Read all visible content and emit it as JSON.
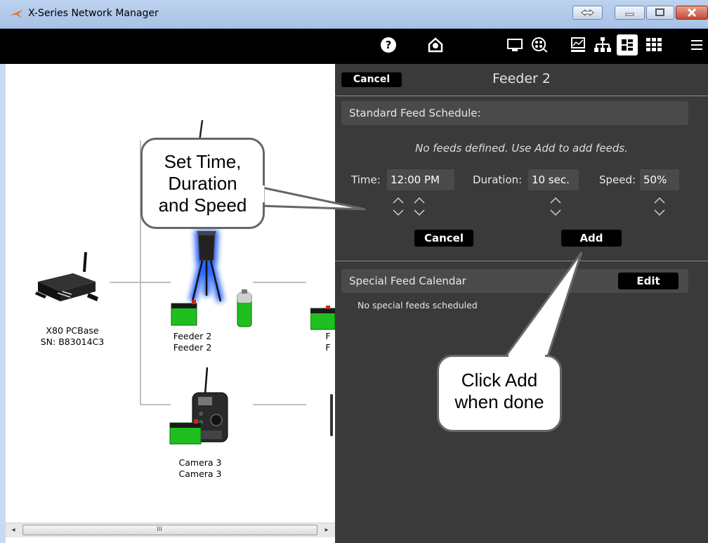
{
  "window": {
    "title": "X-Series Network Manager"
  },
  "toolbar": {
    "icons": [
      "help-icon",
      "support-icon",
      "monitor-icon",
      "camera-film-icon",
      "chart-icon",
      "network-icon",
      "grid-view-icon",
      "apps-icon",
      "menu-icon"
    ]
  },
  "network": {
    "base": {
      "name": "X80 PCBase",
      "serial": "SN: B83014C3"
    },
    "feeder": {
      "name": "Feeder 2",
      "sub": "Feeder 2"
    },
    "camera": {
      "name": "Camera 3",
      "sub": "Camera 3"
    },
    "partial_label_1": "F",
    "partial_label_2": "F"
  },
  "panel": {
    "cancel_label": "Cancel",
    "title": "Feeder 2",
    "standard_schedule_label": "Standard Feed Schedule:",
    "no_feeds_text": "No feeds defined. Use Add to add feeds.",
    "time_label": "Time:",
    "time_value": "12:00 PM",
    "duration_label": "Duration:",
    "duration_value": "10 sec.",
    "speed_label": "Speed:",
    "speed_value": "50%",
    "form_cancel_label": "Cancel",
    "add_label": "Add",
    "special_calendar_label": "Special Feed Calendar",
    "edit_label": "Edit",
    "no_special_text": "No special feeds scheduled"
  },
  "callouts": {
    "set_line1": "Set Time,",
    "set_line2": "Duration",
    "set_line3": "and Speed",
    "click_line1": "Click Add",
    "click_line2": "when done"
  },
  "scrollbar": {
    "left_arrow": "◂",
    "right_arrow": "▸",
    "grip": "III"
  },
  "colors": {
    "panel_bg": "#3a3a3a",
    "battery_green": "#1fbf1f",
    "glow_blue": "#1e5bff"
  }
}
